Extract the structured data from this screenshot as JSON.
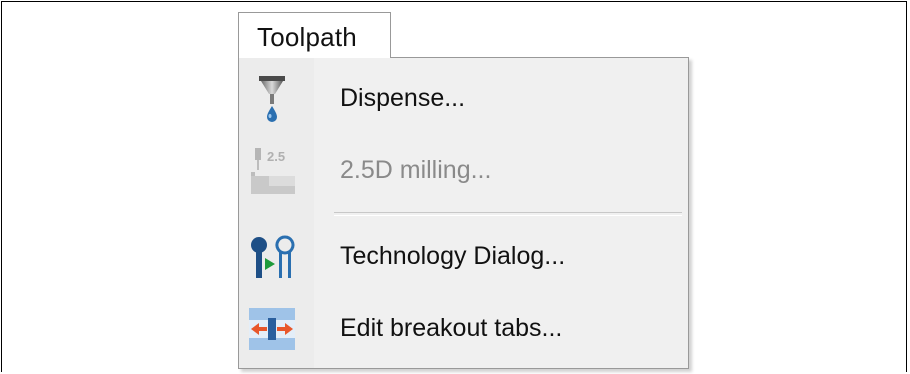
{
  "menu": {
    "title": "Toolpath",
    "items": [
      {
        "label": "Dispense...",
        "icon": "dispense-icon",
        "enabled": true
      },
      {
        "label": "2.5D milling...",
        "icon": "milling-2-5d-icon",
        "enabled": false,
        "icon_text": "2.5"
      },
      {
        "label": "Technology Dialog...",
        "icon": "technology-dialog-icon",
        "enabled": true
      },
      {
        "label": "Edit breakout tabs...",
        "icon": "breakout-tabs-icon",
        "enabled": true
      }
    ]
  },
  "colors": {
    "menu_background": "#f0f0f0",
    "border": "#999999",
    "disabled_text": "#8a8a8a",
    "icon_blue": "#2a6fb0",
    "icon_green": "#1e9a3a",
    "icon_orange": "#e8572b"
  }
}
